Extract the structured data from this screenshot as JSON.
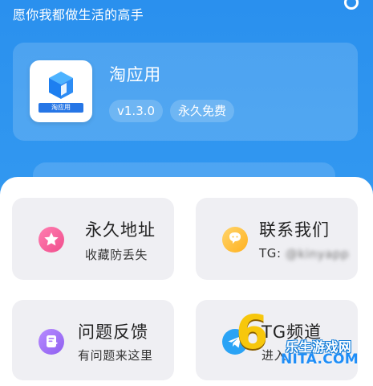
{
  "header": {
    "slogan": "愿你我都做生活的高手"
  },
  "app": {
    "name": "淘应用",
    "icon_caption": "淘应用",
    "version": "v1.3.0",
    "price_label": "永久免费",
    "icon_name": "blue-cube-icon"
  },
  "features": [
    {
      "title": "永久地址",
      "desc": "收藏防丢失",
      "icon": "pink-star-icon"
    },
    {
      "title": "联系我们",
      "desc_prefix": "TG: ",
      "desc_handle": "@kinyapp",
      "icon": "yellow-chat-icon"
    },
    {
      "title": "问题反馈",
      "desc": "有问题来这里",
      "icon": "purple-feedback-icon"
    },
    {
      "title": "TG频道",
      "desc": "进入",
      "icon": "telegram-icon"
    }
  ],
  "watermark": {
    "logo_digit": "6",
    "site_name": "乐生游戏网",
    "site_url": "NITA.COM"
  },
  "colors": {
    "primary": "#2f93ef",
    "card_bg": "#efeff3",
    "panel_bg": "#ffffff"
  }
}
